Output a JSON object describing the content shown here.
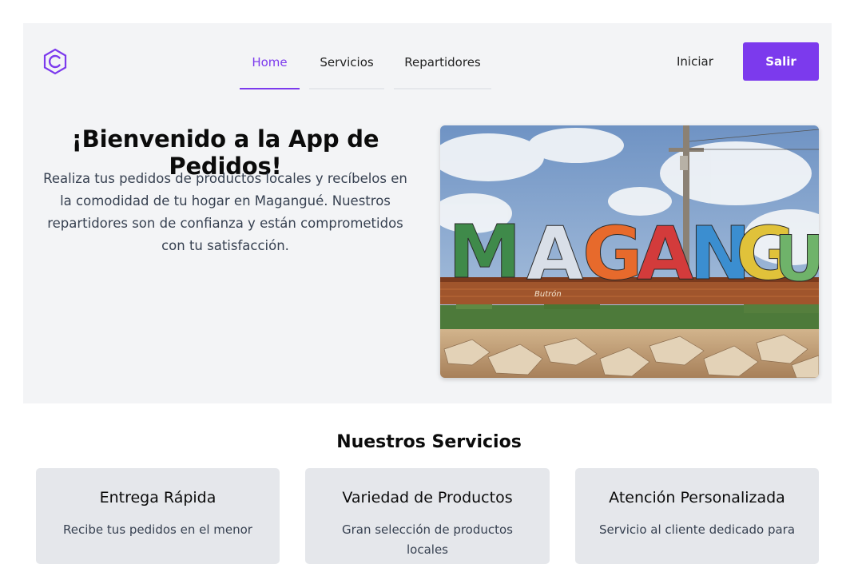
{
  "header": {
    "logo_icon": "c-hexagon-logo-icon",
    "nav": [
      {
        "label": "Home",
        "active": true
      },
      {
        "label": "Servicios",
        "active": false
      },
      {
        "label": "Repartidores",
        "active": false
      }
    ],
    "login_label": "Iniciar",
    "exit_label": "Salir"
  },
  "hero": {
    "title": "¡Bienvenido a la App de Pedidos!",
    "description": "Realiza tus pedidos de productos locales y recíbelos en la comodidad de tu hogar en Magangué. Nuestros repartidores son de confianza y están comprometidos con tu satisfacción.",
    "image_sign_text": "MAGANGUE"
  },
  "services": {
    "title": "Nuestros Servicios",
    "cards": [
      {
        "title": "Entrega Rápida",
        "text": "Recibe tus pedidos en el menor"
      },
      {
        "title": "Variedad de Productos",
        "text": "Gran selección de productos locales"
      },
      {
        "title": "Atención Personalizada",
        "text": "Servicio al cliente dedicado para"
      }
    ]
  },
  "colors": {
    "accent": "#7c3aed",
    "hero_background": "#f3f4f6",
    "card_background": "#e5e7eb"
  }
}
